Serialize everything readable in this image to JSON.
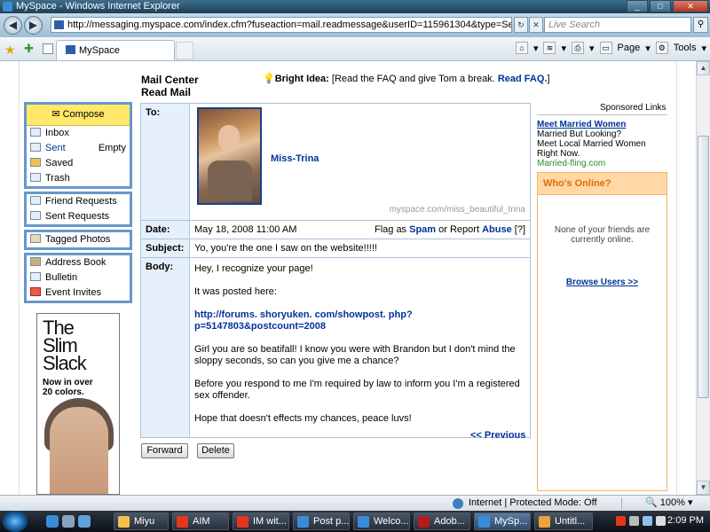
{
  "window": {
    "title": "MySpace - Windows Internet Explorer",
    "controls": [
      "_",
      "□",
      "✕"
    ]
  },
  "address": {
    "url": "http://messaging.myspace.com/index.cfm?fuseaction=mail.readmessage&userID=115961304&type=Sent&messa",
    "search_placeholder": "Live Search"
  },
  "tabbar": {
    "tab_label": "MySpace",
    "page_label": "Page",
    "tools_label": "Tools"
  },
  "header": {
    "title_line1": "Mail Center",
    "title_line2": "Read Mail",
    "bright_idea_label": "Bright Idea:",
    "bright_idea_text": "[Read the FAQ and give Tom a break.",
    "bright_idea_link": "Read FAQ.",
    "bright_idea_end": "]"
  },
  "nav": {
    "compose": "Compose",
    "group1": [
      {
        "label": "Inbox",
        "right": ""
      },
      {
        "label": "Sent",
        "right": "Empty"
      },
      {
        "label": "Saved",
        "right": ""
      },
      {
        "label": "Trash",
        "right": ""
      }
    ],
    "group2": [
      {
        "label": "Friend Requests"
      },
      {
        "label": "Sent Requests"
      }
    ],
    "group3": [
      {
        "label": "Tagged Photos"
      }
    ],
    "group4": [
      {
        "label": "Address Book"
      },
      {
        "label": "Bulletin"
      },
      {
        "label": "Event Invites"
      }
    ]
  },
  "ad": {
    "headline_1": "The",
    "headline_2": "Slim",
    "headline_3": "Slack",
    "sub_1": "Now in over",
    "sub_2": "20 colors."
  },
  "message": {
    "to_label": "To:",
    "recipient_name": "Miss-Trina",
    "profile_url": "myspace.com/miss_beautiful_trina",
    "date_label": "Date:",
    "date_value": "May 18, 2008 11:00 AM",
    "flag_prefix": "Flag as",
    "spam_link": "Spam",
    "or_report": "or Report",
    "abuse_link": "Abuse",
    "help": "[?]",
    "subject_label": "Subject:",
    "subject_value": "Yo, you're the one I saw on the website!!!!!",
    "body_label": "Body:",
    "body_p1": "Hey, I recognize your page!",
    "body_p2": "It was posted here:",
    "body_link_1": "http://forums. shoryuken. com/showpost. php?",
    "body_link_2": "p=5147803&postcount=2008",
    "body_p3": "Girl you are so beatifall! I know you were with Brandon but I don't mind the sloppy seconds, so can you give me a chance?",
    "body_p4": "Before you respond to me I'm required by law to inform you I'm a registered sex offender.",
    "body_p5": "Hope that doesn't effects my chances, peace luvs!",
    "previous_link": "<< Previous",
    "forward_button": "Forward",
    "delete_button": "Delete"
  },
  "right": {
    "sponsored": "Sponsored Links",
    "ad_headline": "Meet Married Women",
    "ad_line1": "Married But Looking?",
    "ad_line2": "Meet Local Married Women",
    "ad_line3": "Right Now.",
    "ad_url": "Married-fling.com",
    "online_header": "Who's Online?",
    "online_none_1": "None of your friends are",
    "online_none_2": "currently online.",
    "browse_users": "Browse Users >>"
  },
  "status": {
    "zone": "Internet | Protected Mode: Off",
    "zoom": "100%"
  },
  "taskbar": {
    "tasks": [
      "Miyu",
      "AIM",
      "IM wit...",
      "Post p...",
      "Welco...",
      "Adob...",
      "MySp...",
      "Untitl..."
    ],
    "clock": "2:09 PM"
  },
  "colors": {
    "nav_border": "#6698cb",
    "compose_bg": "#ffe86a",
    "link": "#003399",
    "online_header_bg": "#ffd8a6"
  }
}
